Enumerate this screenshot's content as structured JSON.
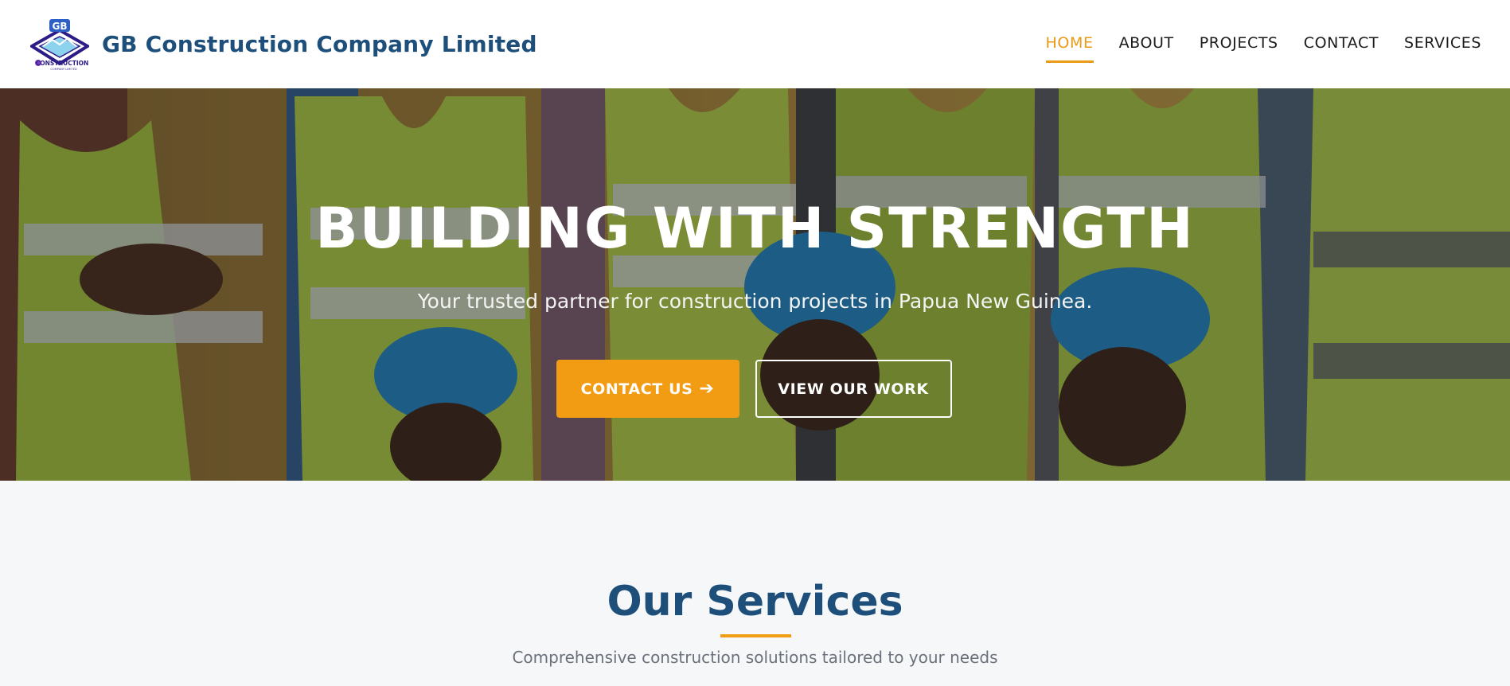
{
  "header": {
    "brand_name": "GB Construction Company Limited",
    "logo": {
      "monogram": "GB",
      "wordmark": "CONSTRUCTION",
      "subline": "COMPANY LIMITED"
    },
    "nav": [
      {
        "label": "HOME",
        "active": true
      },
      {
        "label": "ABOUT",
        "active": false
      },
      {
        "label": "PROJECTS",
        "active": false
      },
      {
        "label": "CONTACT",
        "active": false
      },
      {
        "label": "SERVICES",
        "active": false
      }
    ]
  },
  "hero": {
    "title": "BUILDING WITH STRENGTH",
    "subtitle": "Your trusted partner for construction projects in Papua New Guinea.",
    "primary_button": "CONTACT US",
    "primary_button_icon": "arrow-right-icon",
    "secondary_button": "VIEW OUR WORK"
  },
  "services": {
    "title": "Our Services",
    "subtitle": "Comprehensive construction solutions tailored to your needs"
  },
  "colors": {
    "brand_blue": "#1d4f7a",
    "accent_orange": "#f29c13",
    "nav_active": "#e99a16",
    "section_bg": "#f6f7f9"
  }
}
